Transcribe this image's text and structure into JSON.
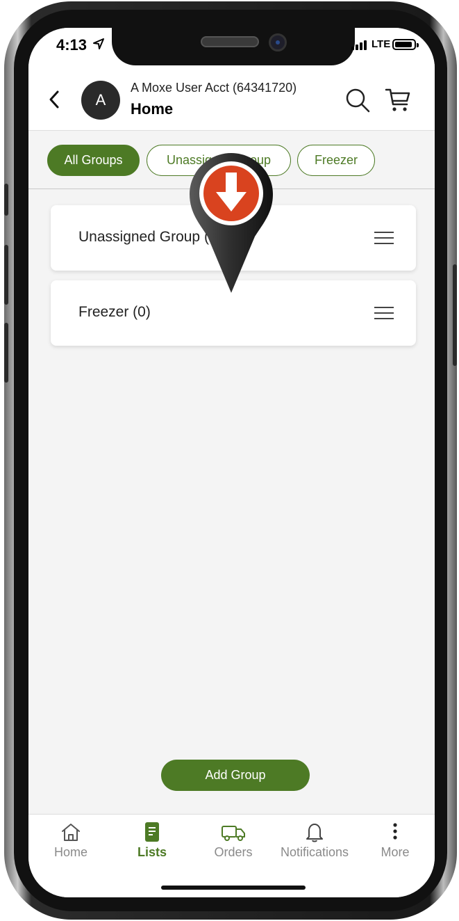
{
  "status_bar": {
    "time": "4:13",
    "network": "LTE"
  },
  "header": {
    "avatar_initial": "A",
    "account_name": "A Moxe User Acct (64341720)",
    "title": "Home"
  },
  "filters": {
    "chips": [
      {
        "label": "All Groups",
        "active": true
      },
      {
        "label": "Unassigned Group",
        "active": false
      },
      {
        "label": "Freezer",
        "active": false
      }
    ]
  },
  "groups": [
    {
      "label": "Unassigned Group (1)"
    },
    {
      "label": "Freezer (0)"
    }
  ],
  "add_group_label": "Add Group",
  "tabbar": {
    "items": [
      {
        "label": "Home",
        "icon": "home-icon",
        "active": false
      },
      {
        "label": "Lists",
        "icon": "list-icon",
        "active": true
      },
      {
        "label": "Orders",
        "icon": "truck-icon",
        "active": false
      },
      {
        "label": "Notifications",
        "icon": "bell-icon",
        "active": false
      },
      {
        "label": "More",
        "icon": "more-vertical-icon",
        "active": false
      }
    ]
  },
  "colors": {
    "accent": "#4d7a25",
    "pin_red": "#d9431f",
    "pin_body": "#3a3a3a"
  }
}
